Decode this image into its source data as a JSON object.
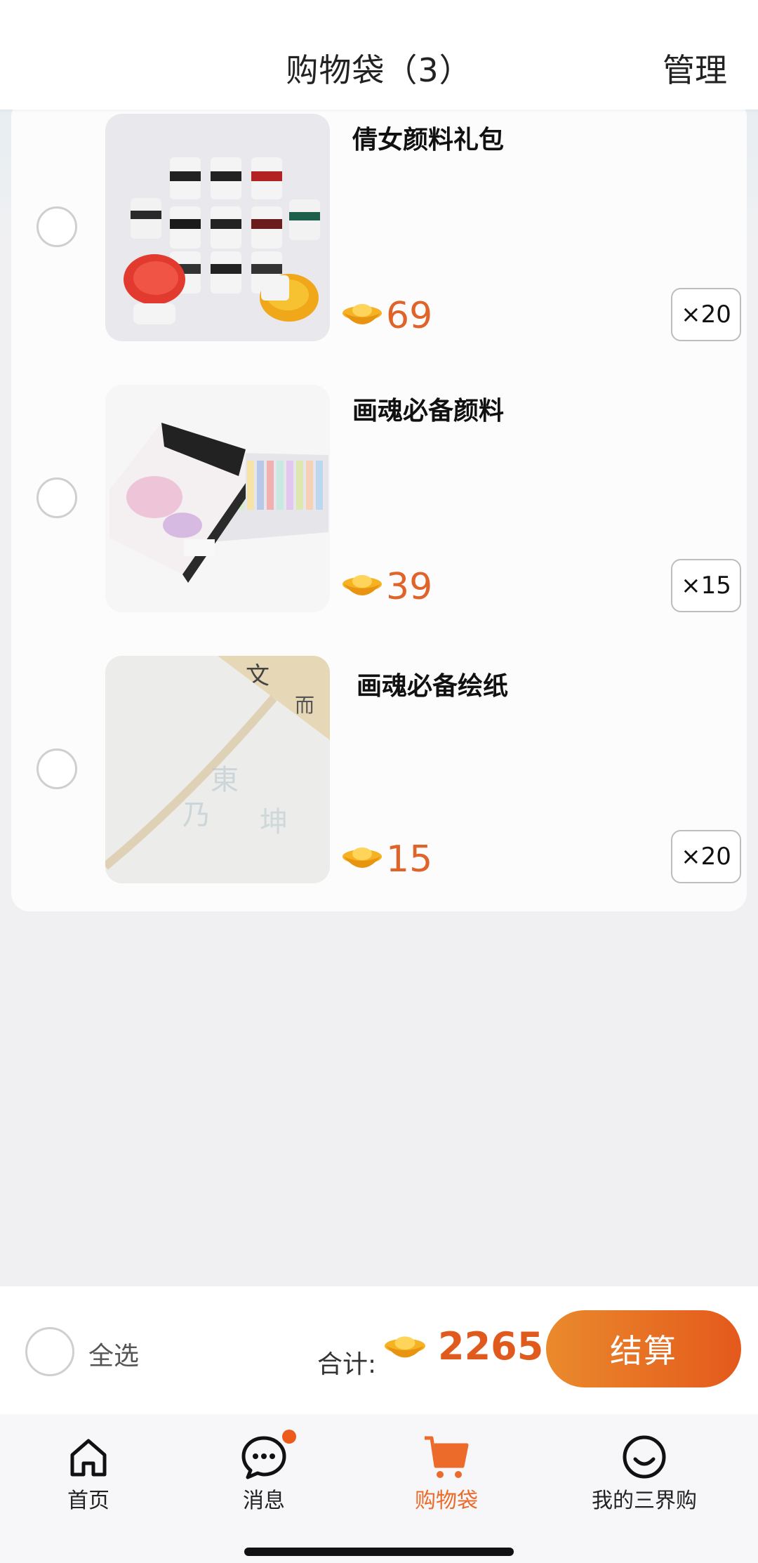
{
  "header": {
    "title": "购物袋（3）",
    "manage": "管理"
  },
  "items": [
    {
      "title": "倩女颜料礼包",
      "price": "69",
      "qty": "×20",
      "image": "paint-jars"
    },
    {
      "title": "画魂必备颜料",
      "price": "39",
      "qty": "×15",
      "image": "pastel-box"
    },
    {
      "title": "画魂必备绘纸",
      "price": "15",
      "qty": "×20",
      "image": "rice-paper"
    }
  ],
  "checkout": {
    "select_all": "全选",
    "total_label": "合计:",
    "total_value": "2265",
    "pay_label": "结算"
  },
  "tabs": [
    {
      "label": "首页",
      "icon": "home-icon"
    },
    {
      "label": "消息",
      "icon": "message-icon",
      "badge": true
    },
    {
      "label": "购物袋",
      "icon": "cart-icon",
      "active": true
    },
    {
      "label": "我的三界购",
      "icon": "smile-icon"
    }
  ],
  "colors": {
    "accent": "#e4591c",
    "price": "#e0642a",
    "active_tab": "#ec6a2a"
  }
}
